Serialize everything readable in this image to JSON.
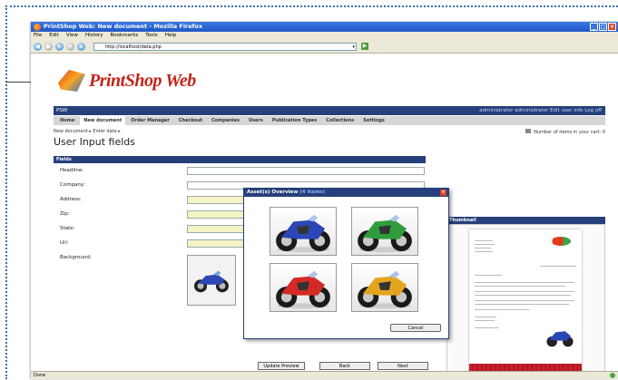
{
  "browser": {
    "title": "PrintShop Web: New document - Mozilla Firefox",
    "menu": [
      "File",
      "Edit",
      "View",
      "History",
      "Bookmarks",
      "Tools",
      "Help"
    ],
    "url": "http://localhost/data.php",
    "status": "Done"
  },
  "app": {
    "logo_text": "PrintShop Web",
    "header": "PSW",
    "user": "administrator administrator  Edit user info  Log off",
    "tabs": [
      "Home",
      "New document",
      "Order Manager",
      "Checkout",
      "Companies",
      "Users",
      "Publication Types",
      "Collections",
      "Settings"
    ],
    "active_tab": "New document",
    "breadcrumb": "New document  ▸ Enter data ▸",
    "cart": "Number of items in your cart: 0",
    "page_title": "User Input fields",
    "fields_header": "Fields",
    "thumbnail_header": "Thumbnail",
    "fields": [
      "Headline:",
      "Company:",
      "Address:",
      "Zip:",
      "State:",
      "Url:",
      "Background:"
    ],
    "buttons": {
      "update": "Update Preview",
      "back": "Back",
      "next": "Next"
    }
  },
  "modal": {
    "title": "Asset(s) Overview",
    "count": "(4 items)",
    "cancel": "Cancel",
    "bike_colors": [
      "#2a47b5",
      "#2f9d3c",
      "#d42a25",
      "#e3a51f"
    ]
  }
}
